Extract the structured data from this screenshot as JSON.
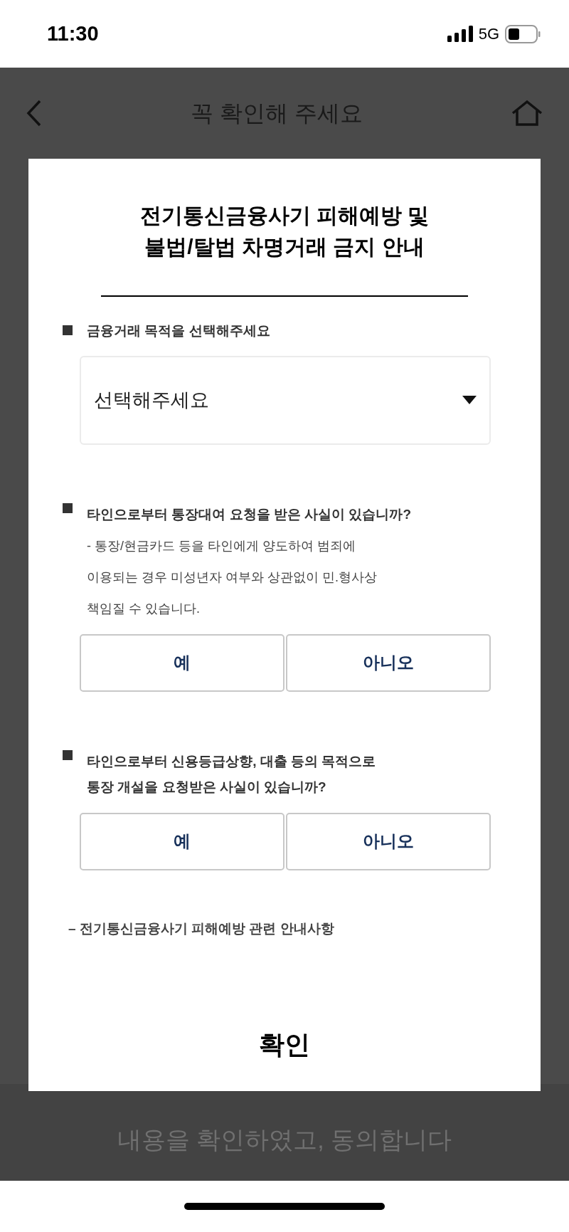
{
  "status_bar": {
    "time": "11:30",
    "network": "5G"
  },
  "header": {
    "title": "꼭 확인해 주세요"
  },
  "dialog": {
    "title_lines": [
      "전기통신금융사기 피해예방 및",
      "불법/탈법 차명거래 금지 안내"
    ],
    "purpose": {
      "heading": "금융거래 목적을 선택해주세요",
      "select_value": "선택해주세요"
    },
    "questions": [
      {
        "heading_lines": [
          "타인으로부터 통장대여 요청을 받은 사실이 있습니까?"
        ],
        "note_lines": [
          "- 통장/현금카드 등을 타인에게 양도하여 범죄에",
          "이용되는 경우 미성년자 여부와 상관없이 민.형사상",
          "책임질 수 있습니다."
        ],
        "answers": [
          "예",
          "아니오"
        ]
      },
      {
        "heading_lines": [
          "타인으로부터 신용등급상향, 대출 등의 목적으로",
          "통장 개설을 요청받은 사실이 있습니까?"
        ],
        "answers": [
          "예",
          "아니오"
        ]
      }
    ],
    "notice_heading": "– 전기통신금융사기 피해예방 관련 안내사항",
    "confirm_button": "확인"
  },
  "footer_button": {
    "label": "내용을 확인하였고, 동의합니다",
    "disabled": true
  }
}
